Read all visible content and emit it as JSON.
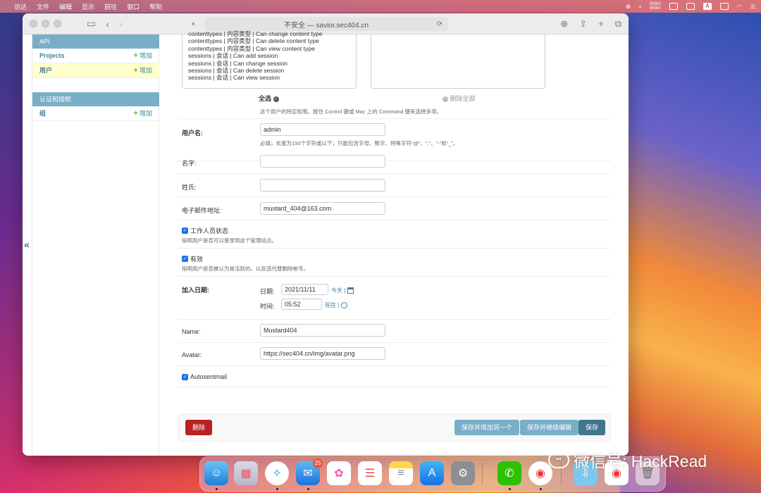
{
  "menubar": {
    "apple": "",
    "items": [
      "访达",
      "文件",
      "编辑",
      "显示",
      "前往",
      "窗口",
      "帮助"
    ],
    "net": "0KB/s"
  },
  "browser": {
    "url": "不安全 — savior.sec404.cn"
  },
  "sidebar": {
    "modules": [
      {
        "caption": "API",
        "rows": [
          {
            "name": "Projects",
            "add": "增加",
            "active": false
          },
          {
            "name": "用户",
            "add": "增加",
            "active": true
          }
        ]
      },
      {
        "caption": "认证和授权",
        "rows": [
          {
            "name": "组",
            "add": "增加",
            "active": false
          }
        ]
      }
    ],
    "collapse": "«"
  },
  "permissions": {
    "partial_top": "contenttypes | 内容类型 | Can change content type",
    "lines": [
      "contenttypes | 内容类型 | Can delete content type",
      "contenttypes | 内容类型 | Can view content type",
      "sessions | 会话 | Can add session",
      "sessions | 会话 | Can change session",
      "sessions | 会话 | Can delete session",
      "sessions | 会话 | Can view session"
    ],
    "choose_all": "全选",
    "remove_all": "删除全部",
    "help": "这个用户的特定权限。按住 Control 键或 Mac 上的 Command 键来选择多项。"
  },
  "form": {
    "username": {
      "label": "用户名:",
      "value": "admin",
      "help": "必填；长度为150个字符或以下；只能包含字母、数字、特殊字符“@”、“.”、“-”和“_”。"
    },
    "first_name": {
      "label": "名字:",
      "value": ""
    },
    "last_name": {
      "label": "姓氏:",
      "value": ""
    },
    "email": {
      "label": "电子邮件地址:",
      "value": "mustard_404@163.com"
    },
    "is_staff": {
      "label": "工作人员状态",
      "help": "指明用户是否可以登录到这个管理站点。"
    },
    "is_active": {
      "label": "有效",
      "help": "指明用户是否被认为是活跃的。以反选代替删除帐号。"
    },
    "date_joined": {
      "label": "加入日期:",
      "date_label": "日期:",
      "date": "2021/11/11",
      "today": "今天",
      "time_label": "时间:",
      "time": "05:52",
      "now": "现在"
    },
    "name": {
      "label": "Name:",
      "value": "Mustard404"
    },
    "avatar": {
      "label": "Avatar:",
      "value": "https://sec404.cn/img/avatar.png"
    },
    "autosentmail": {
      "label": "Autosentmail"
    }
  },
  "buttons": {
    "delete": "删除",
    "save_add": "保存并增加另一个",
    "save_continue": "保存并继续编辑",
    "save": "保存"
  },
  "dock": {
    "mail_badge": "25"
  },
  "watermark": "微信号: HackRead"
}
